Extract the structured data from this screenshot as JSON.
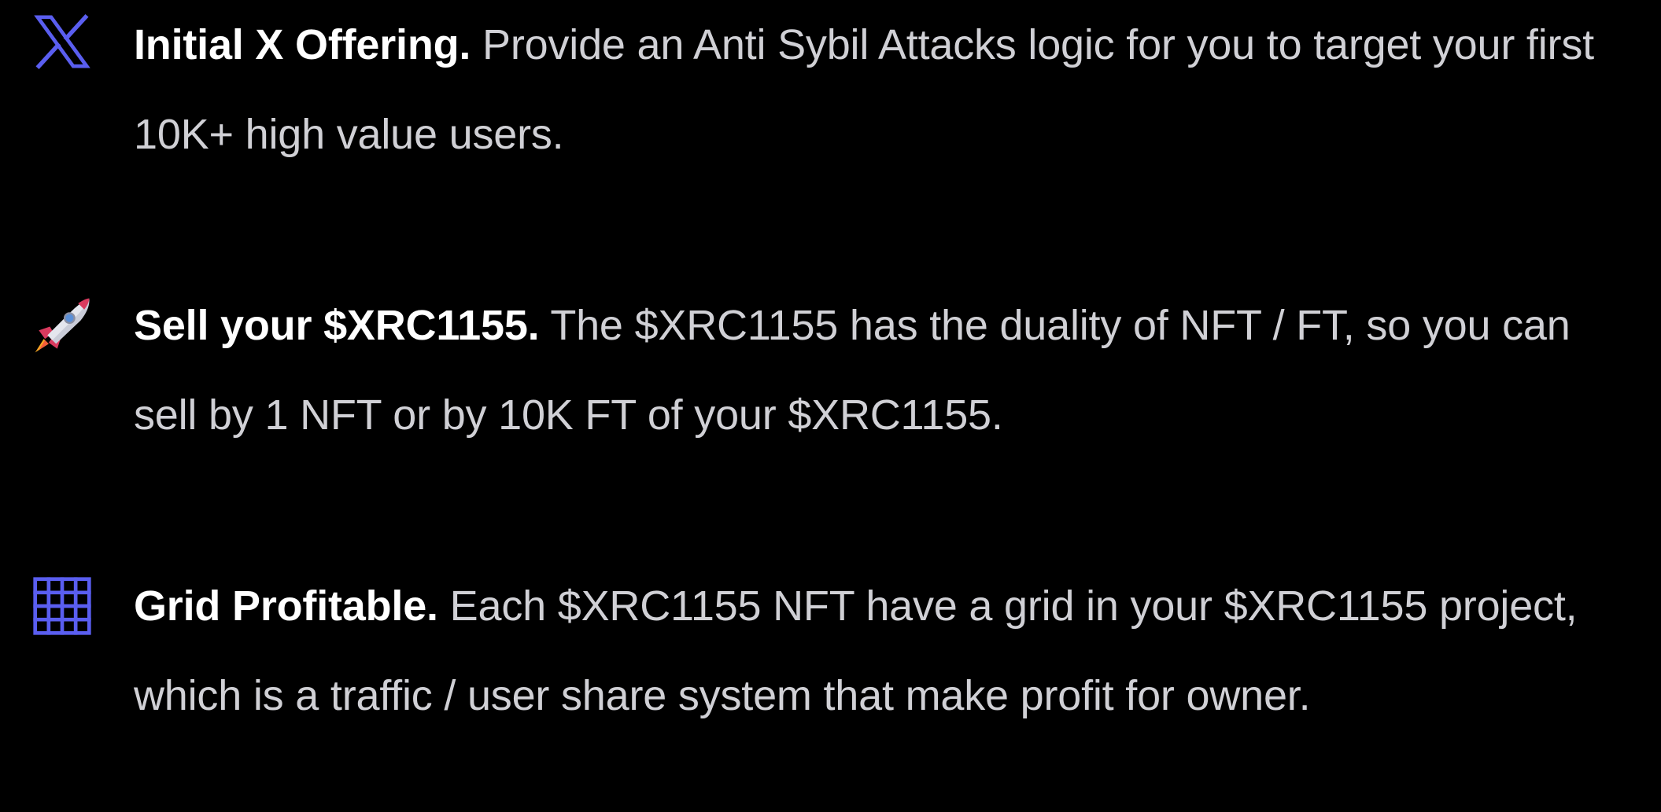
{
  "features": [
    {
      "icon": "x-logo-icon",
      "title": "Initial X Offering.",
      "description": "Provide an Anti Sybil Attacks logic for you to target your first 10K+ high value users."
    },
    {
      "icon": "rocket-icon",
      "title": "Sell your $XRC1155.",
      "description": "The $XRC1155 has the duality of NFT / FT, so you can sell by 1 NFT or by 10K FT of your $XRC1155."
    },
    {
      "icon": "grid-icon",
      "title": "Grid Profitable.",
      "description": "Each $XRC1155 NFT have a grid in your $XRC1155 project, which is a traffic / user share system that make profit for owner."
    }
  ],
  "colors": {
    "background": "#000000",
    "title": "#ffffff",
    "description": "#d0d0d5",
    "accent": "#5a5ef0"
  }
}
